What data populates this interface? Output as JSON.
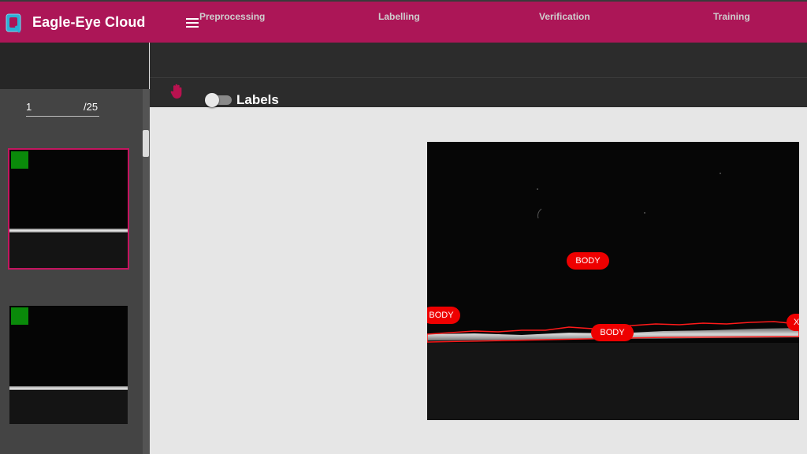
{
  "header": {
    "app_title": "Eagle-Eye Cloud",
    "logo_icon": "eagle-eye-logo",
    "menu_icon": "hamburger-menu-icon",
    "brand_color": "#ac1657"
  },
  "pagination": {
    "current": "1",
    "total": "/25"
  },
  "tabs": [
    {
      "label": "Preprocessing"
    },
    {
      "label": "Labelling"
    },
    {
      "label": "Verification"
    },
    {
      "label": "Training"
    }
  ],
  "toolbar": {
    "pan_icon": "hand-icon",
    "labels_toggle": {
      "label": "Labels",
      "checked": false
    }
  },
  "thumbnails": [
    {
      "selected": true,
      "status_color": "#0a8a0a"
    },
    {
      "selected": false,
      "status_color": "#0a8a0a"
    }
  ],
  "annotations": [
    {
      "label": "BODY"
    },
    {
      "label": "BODY"
    },
    {
      "label": "BODY"
    },
    {
      "label": "X"
    }
  ],
  "colors": {
    "annotation": "#ee0000",
    "status_ok": "#0a8a0a",
    "selection": "#c41560"
  }
}
